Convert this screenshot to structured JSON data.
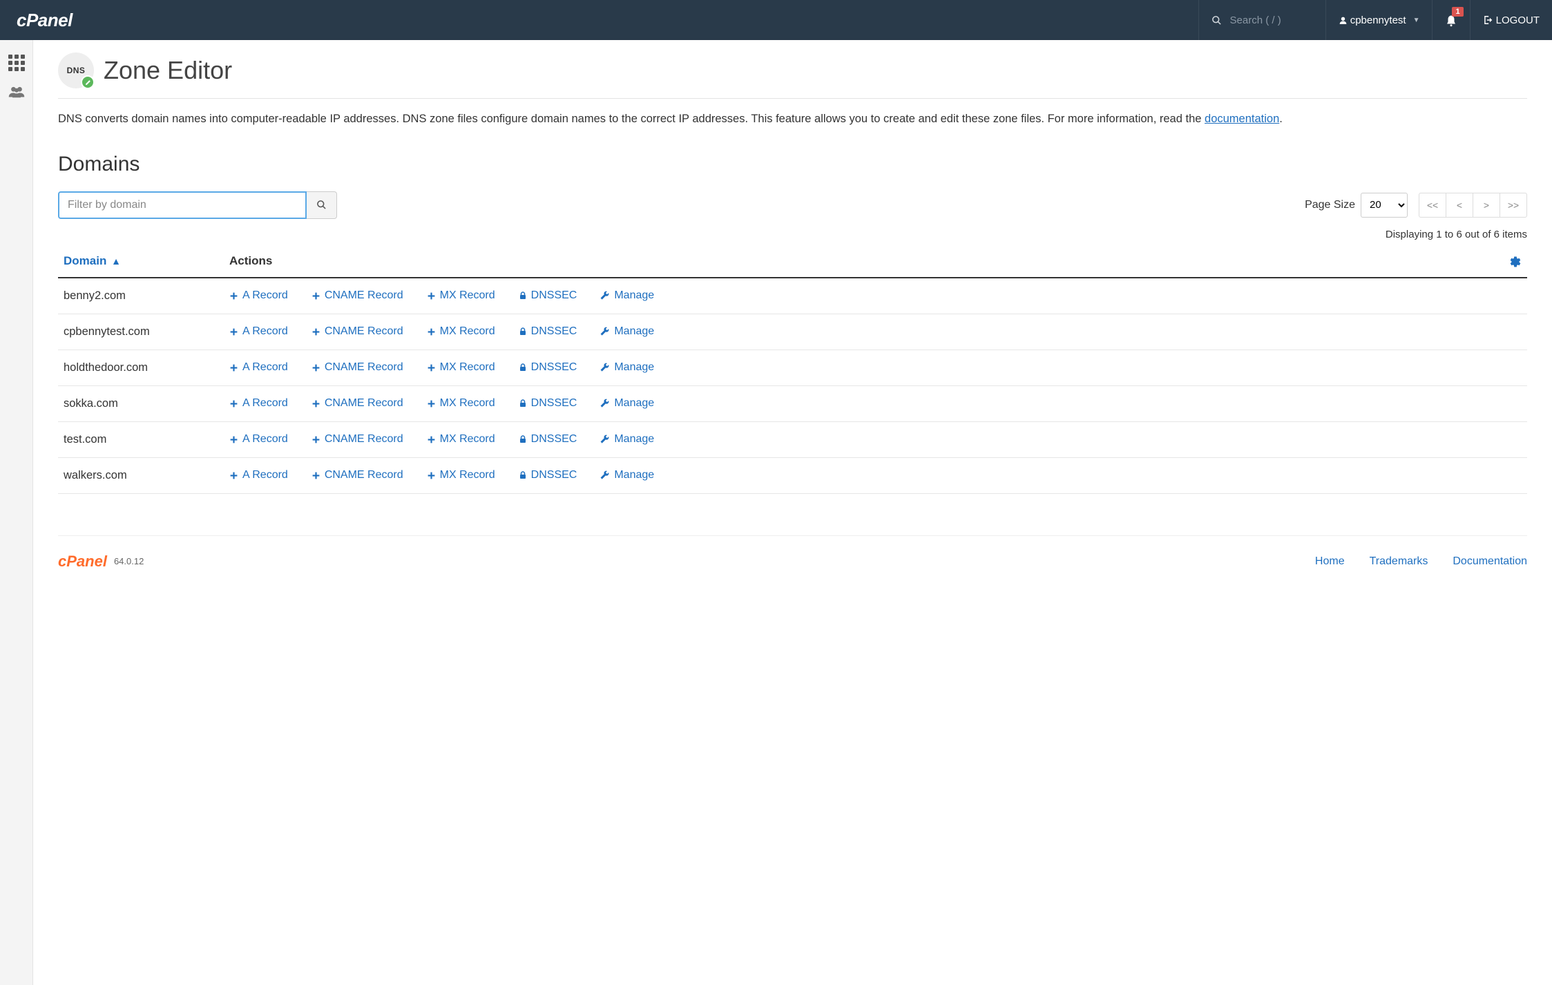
{
  "topbar": {
    "search_placeholder": "Search ( / )",
    "username": "cpbennytest",
    "notification_count": "1",
    "logout_label": "LOGOUT"
  },
  "page": {
    "icon_text": "DNS",
    "title": "Zone Editor",
    "description_prefix": "DNS converts domain names into computer-readable IP addresses. DNS zone files configure domain names to the correct IP addresses. This feature allows you to create and edit these zone files. For more information, read the ",
    "doc_link_label": "documentation",
    "description_suffix": "."
  },
  "domains_section": {
    "title": "Domains",
    "filter_placeholder": "Filter by domain",
    "page_size_label": "Page Size",
    "page_size_value": "20",
    "pager_first": "<<",
    "pager_prev": "<",
    "pager_next": ">",
    "pager_last": ">>",
    "display_text": "Displaying 1 to 6 out of 6 items"
  },
  "table": {
    "col_domain": "Domain",
    "col_actions": "Actions",
    "action_a": "A Record",
    "action_cname": "CNAME Record",
    "action_mx": "MX Record",
    "action_dnssec": "DNSSEC",
    "action_manage": "Manage",
    "rows": [
      {
        "domain": "benny2.com"
      },
      {
        "domain": "cpbennytest.com"
      },
      {
        "domain": "holdthedoor.com"
      },
      {
        "domain": "sokka.com"
      },
      {
        "domain": "test.com"
      },
      {
        "domain": "walkers.com"
      }
    ]
  },
  "footer": {
    "version": "64.0.12",
    "links": {
      "home": "Home",
      "trademarks": "Trademarks",
      "documentation": "Documentation"
    }
  }
}
